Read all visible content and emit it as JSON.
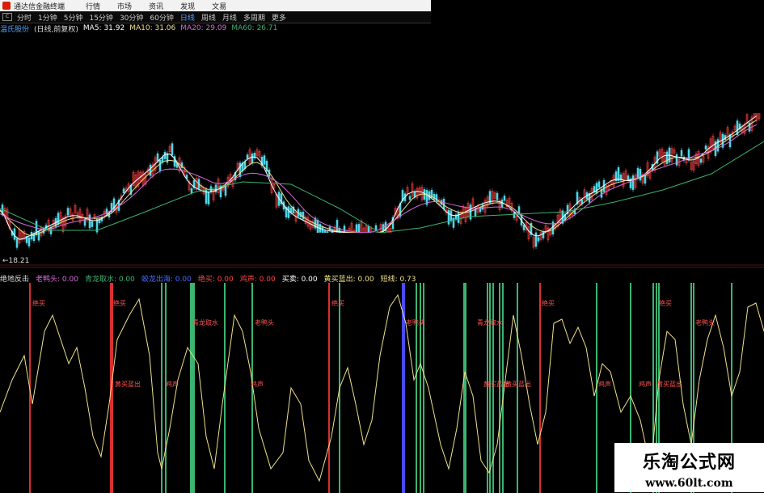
{
  "menubar": {
    "app_title": "通达信金融终端",
    "items": [
      "行情",
      "市场",
      "资讯",
      "发现",
      "文易"
    ]
  },
  "periodbar": {
    "items": [
      "分时",
      "1分钟",
      "5分钟",
      "15分钟",
      "30分钟",
      "60分钟",
      "日线",
      "周线",
      "月线",
      "多周期",
      "更多"
    ],
    "active": "日线"
  },
  "mabar": {
    "stock": "温氏股份",
    "mode": "(日线,前复权)",
    "ma5": "MA5: 31.92",
    "ma10": "MA10: 31.06",
    "ma20": "MA20: 29.09",
    "ma60": "MA60: 26.71",
    "colors": {
      "stock": "#4aa3ff",
      "ma5": "#ffffff",
      "ma10": "#f0e08a",
      "ma20": "#d96bd9",
      "ma60": "#3cb371"
    }
  },
  "low_label": "←18.21",
  "indicator_bar": {
    "name": "绝地反击",
    "items": [
      {
        "text": "老鸭头: 0.00",
        "color": "#d96bd9"
      },
      {
        "text": "青龙取水: 0.00",
        "color": "#3cb371"
      },
      {
        "text": "蛟龙出海: 0.00",
        "color": "#4a6bff"
      },
      {
        "text": "绝买: 0.00",
        "color": "#ff4444"
      },
      {
        "text": "鸡声: 0.00",
        "color": "#ff4444"
      },
      {
        "text": "买卖: 0.00",
        "color": "#ffffff"
      },
      {
        "text": "黄买蓝出: 0.00",
        "color": "#f0e08a"
      },
      {
        "text": "短线: 0.73",
        "color": "#f0e08a"
      }
    ]
  },
  "signal_labels": [
    {
      "text": "绝买",
      "kind": "red"
    },
    {
      "text": "绝买",
      "kind": "red"
    },
    {
      "text": "绝买",
      "kind": "red"
    },
    {
      "text": "绝买",
      "kind": "red"
    },
    {
      "text": "绝买",
      "kind": "red"
    },
    {
      "text": "青龙取水",
      "kind": "red"
    },
    {
      "text": "老鸭头",
      "kind": "red"
    },
    {
      "text": "老鸭头",
      "kind": "red"
    },
    {
      "text": "青龙取水",
      "kind": "red"
    },
    {
      "text": "老鸭头",
      "kind": "red"
    },
    {
      "text": "黄买蓝出",
      "kind": "red"
    },
    {
      "text": "黄买蓝出",
      "kind": "red"
    },
    {
      "text": "黄买蓝出",
      "kind": "red"
    },
    {
      "text": "黄买蓝出",
      "kind": "red"
    },
    {
      "text": "鸡声",
      "kind": "red"
    },
    {
      "text": "鸡声",
      "kind": "red"
    },
    {
      "text": "鸡声",
      "kind": "red"
    },
    {
      "text": "鸡声",
      "kind": "red"
    }
  ],
  "watermark": {
    "line1": "乐淘公式网",
    "line2": "www.60lt.com"
  }
}
